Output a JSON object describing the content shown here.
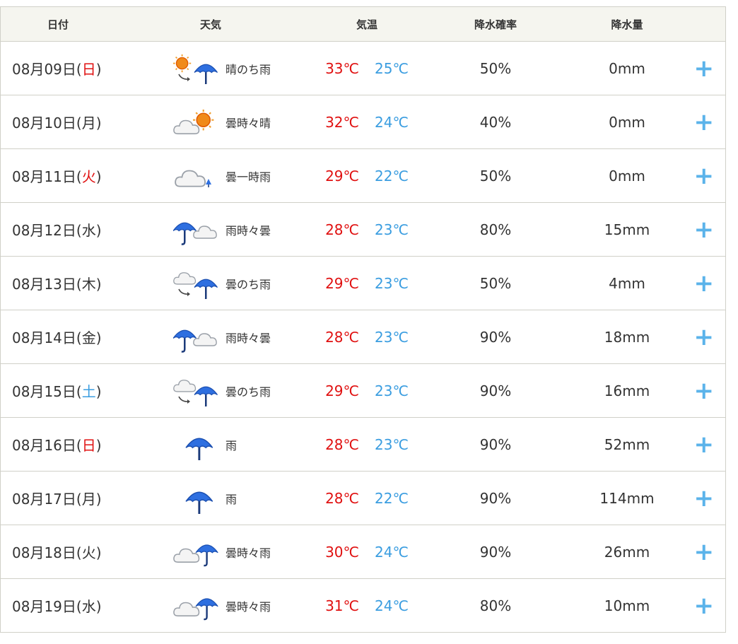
{
  "header": {
    "date": "日付",
    "weather": "天気",
    "temp": "気温",
    "pop": "降水確率",
    "amount": "降水量"
  },
  "rows": [
    {
      "date_prefix": "08月09日(",
      "dow": "日",
      "dow_color": "red",
      "date_suffix": ")",
      "weather": "晴のち雨",
      "icon": "sun-then-rain-icon",
      "high": "33℃",
      "low": "25℃",
      "pop": "50%",
      "amount": "0mm"
    },
    {
      "date_prefix": "08月10日(",
      "dow": "月",
      "dow_color": "normal",
      "date_suffix": ")",
      "weather": "曇時々晴",
      "icon": "cloud-sometimes-sun-icon",
      "high": "32℃",
      "low": "24℃",
      "pop": "40%",
      "amount": "0mm"
    },
    {
      "date_prefix": "08月11日(",
      "dow": "火",
      "dow_color": "red",
      "date_suffix": ")",
      "weather": "曇一時雨",
      "icon": "cloud-occasional-rain-icon",
      "high": "29℃",
      "low": "22℃",
      "pop": "50%",
      "amount": "0mm"
    },
    {
      "date_prefix": "08月12日(",
      "dow": "水",
      "dow_color": "normal",
      "date_suffix": ")",
      "weather": "雨時々曇",
      "icon": "rain-sometimes-cloud-icon",
      "high": "28℃",
      "low": "23℃",
      "pop": "80%",
      "amount": "15mm"
    },
    {
      "date_prefix": "08月13日(",
      "dow": "木",
      "dow_color": "normal",
      "date_suffix": ")",
      "weather": "曇のち雨",
      "icon": "cloud-then-rain-icon",
      "high": "29℃",
      "low": "23℃",
      "pop": "50%",
      "amount": "4mm"
    },
    {
      "date_prefix": "08月14日(",
      "dow": "金",
      "dow_color": "normal",
      "date_suffix": ")",
      "weather": "雨時々曇",
      "icon": "rain-sometimes-cloud-icon",
      "high": "28℃",
      "low": "23℃",
      "pop": "90%",
      "amount": "18mm"
    },
    {
      "date_prefix": "08月15日(",
      "dow": "土",
      "dow_color": "blue",
      "date_suffix": ")",
      "weather": "曇のち雨",
      "icon": "cloud-then-rain-icon",
      "high": "29℃",
      "low": "23℃",
      "pop": "90%",
      "amount": "16mm"
    },
    {
      "date_prefix": "08月16日(",
      "dow": "日",
      "dow_color": "red",
      "date_suffix": ")",
      "weather": "雨",
      "icon": "rain-icon",
      "high": "28℃",
      "low": "23℃",
      "pop": "90%",
      "amount": "52mm"
    },
    {
      "date_prefix": "08月17日(",
      "dow": "月",
      "dow_color": "normal",
      "date_suffix": ")",
      "weather": "雨",
      "icon": "rain-icon",
      "high": "28℃",
      "low": "22℃",
      "pop": "90%",
      "amount": "114mm"
    },
    {
      "date_prefix": "08月18日(",
      "dow": "火",
      "dow_color": "normal",
      "date_suffix": ")",
      "weather": "曇時々雨",
      "icon": "cloud-sometimes-rain-icon",
      "high": "30℃",
      "low": "24℃",
      "pop": "90%",
      "amount": "26mm"
    },
    {
      "date_prefix": "08月19日(",
      "dow": "水",
      "dow_color": "normal",
      "date_suffix": ")",
      "weather": "曇時々雨",
      "icon": "cloud-sometimes-rain-icon",
      "high": "31℃",
      "low": "24℃",
      "pop": "80%",
      "amount": "10mm"
    }
  ],
  "expand_symbol": "+",
  "colors": {
    "high": "#e01010",
    "low": "#3a9de0",
    "header_bg": "#f5f5ef",
    "border": "#d0d0c8",
    "plus": "#5bb3ea"
  }
}
